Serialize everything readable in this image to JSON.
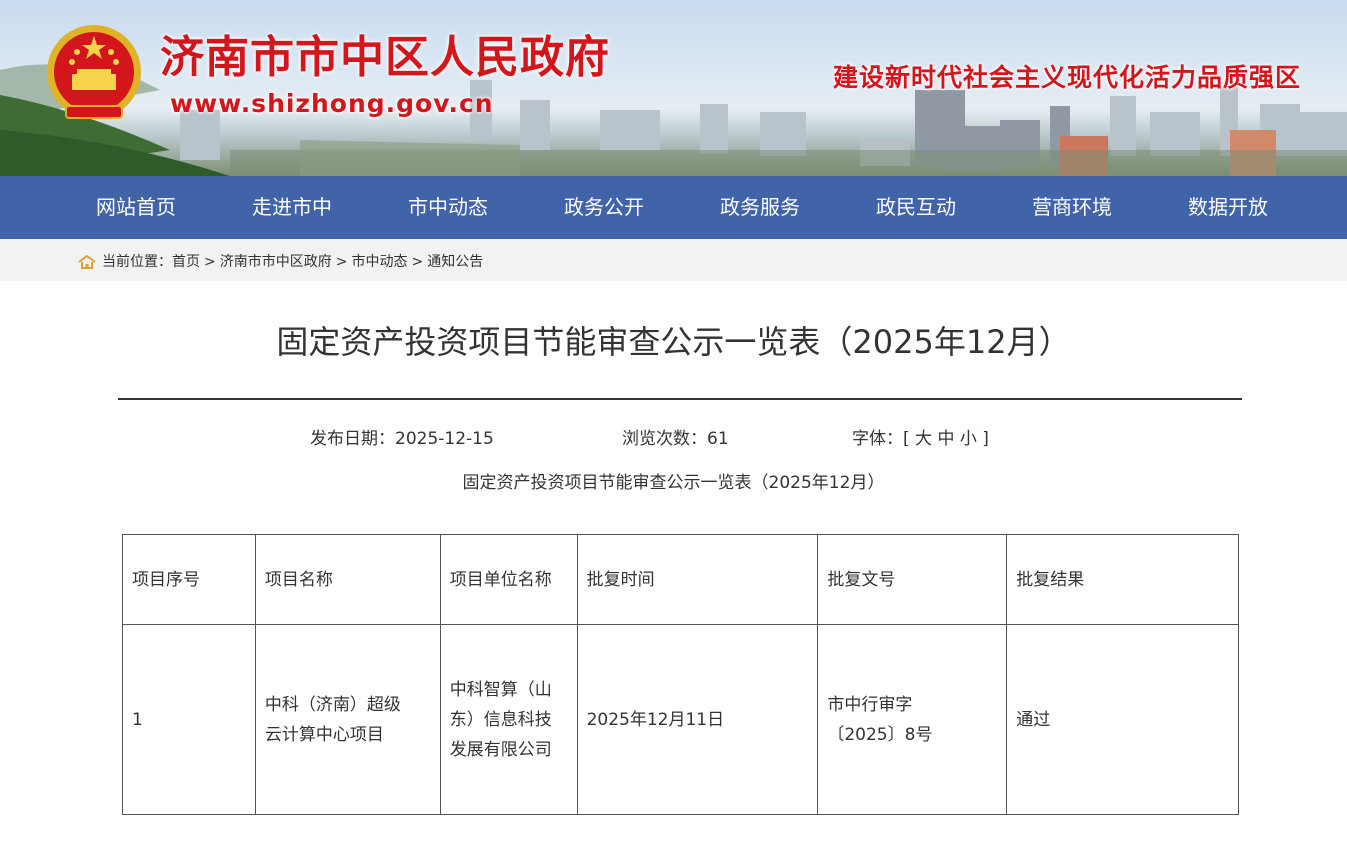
{
  "header": {
    "site_name": "济南市市中区人民政府",
    "site_url": "www.shizhong.gov.cn",
    "slogan": "建设新时代社会主义现代化活力品质强区",
    "emblem_icon": "national-emblem-icon"
  },
  "nav": {
    "items": [
      {
        "label": "网站首页"
      },
      {
        "label": "走进市中"
      },
      {
        "label": "市中动态"
      },
      {
        "label": "政务公开"
      },
      {
        "label": "政务服务"
      },
      {
        "label": "政民互动"
      },
      {
        "label": "营商环境"
      },
      {
        "label": "数据开放"
      }
    ]
  },
  "breadcrumb": {
    "prefix": "当前位置：",
    "items": [
      "首页",
      "济南市市中区政府",
      "市中动态",
      "通知公告"
    ],
    "separator": ">",
    "icon": "home-icon"
  },
  "article": {
    "title": "固定资产投资项目节能审查公示一览表（2025年12月）",
    "publish_label": "发布日期：2025-12-15",
    "views_label": "浏览次数：61",
    "font_label": "字体：[",
    "font_large": "大",
    "font_medium": "中",
    "font_small": "小",
    "font_close": "]",
    "subtitle": "固定资产投资项目节能审查公示一览表（2025年12月）"
  },
  "table": {
    "headers": [
      "项目序号",
      "项目名称",
      "项目单位名称",
      "批复时间",
      "批复文号",
      "批复结果"
    ],
    "rows": [
      {
        "seq": "1",
        "name_line1": "中科（济南）超级",
        "name_line2": "云计算中心项目",
        "unit_line1": "中科智算（山",
        "unit_line2": "东）信息科技",
        "unit_line3": "发展有限公司",
        "date": "2025年12月11日",
        "doc_line1": "市中行审字",
        "doc_line2": "〔2025〕8号",
        "result": "通过"
      }
    ]
  },
  "colors": {
    "brand_red": "#d2161b",
    "nav_blue": "#4163a8",
    "crumb_bg": "#f2f2f2",
    "home_icon": "#e0a030"
  }
}
